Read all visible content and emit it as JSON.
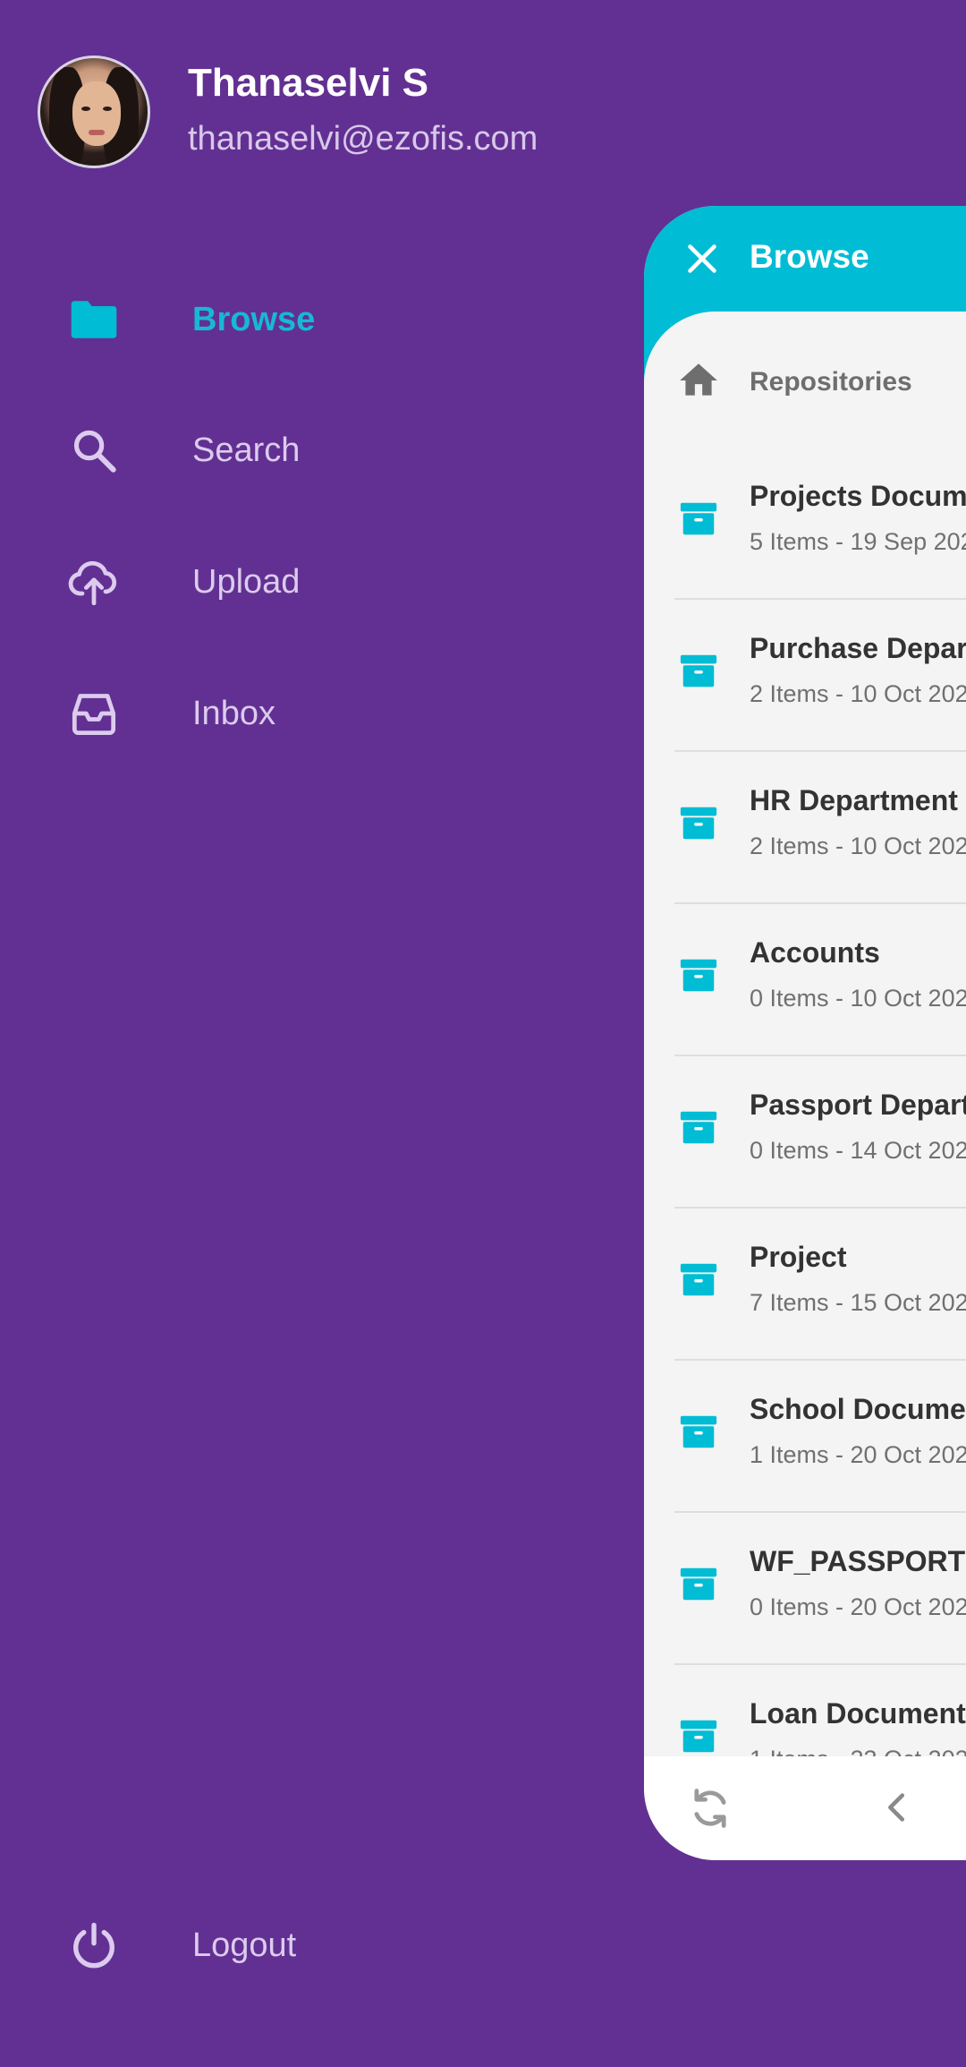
{
  "user": {
    "name": "Thanaselvi S",
    "email": "thanaselvi@ezofis.com"
  },
  "menu": {
    "items": [
      {
        "label": "Browse",
        "icon": "folder-icon",
        "active": true
      },
      {
        "label": "Search",
        "icon": "search-icon",
        "active": false
      },
      {
        "label": "Upload",
        "icon": "cloud-upload-icon",
        "active": false
      },
      {
        "label": "Inbox",
        "icon": "inbox-icon",
        "active": false
      }
    ],
    "logout_label": "Logout"
  },
  "panel": {
    "title": "Browse",
    "breadcrumb": "Repositories",
    "items": [
      {
        "title": "Projects Docume",
        "subtitle": "5 Items - 19 Sep 202"
      },
      {
        "title": "Purchase Depart",
        "subtitle": "2 Items - 10 Oct 202"
      },
      {
        "title": "HR Department",
        "subtitle": "2 Items - 10 Oct 202"
      },
      {
        "title": "Accounts",
        "subtitle": "0 Items - 10 Oct 202"
      },
      {
        "title": "Passport Departn",
        "subtitle": "0 Items - 14 Oct 202"
      },
      {
        "title": "Project",
        "subtitle": "7 Items - 15 Oct 202"
      },
      {
        "title": "School Documen",
        "subtitle": "1 Items - 20 Oct 202"
      },
      {
        "title": "WF_PASSPORT",
        "subtitle": "0 Items - 20 Oct 202"
      },
      {
        "title": "Loan Documents",
        "subtitle": "1 Items - 23 Oct 202"
      }
    ]
  },
  "colors": {
    "background": "#623092",
    "accent": "#00bcd4",
    "menu_text": "#dccbee"
  }
}
